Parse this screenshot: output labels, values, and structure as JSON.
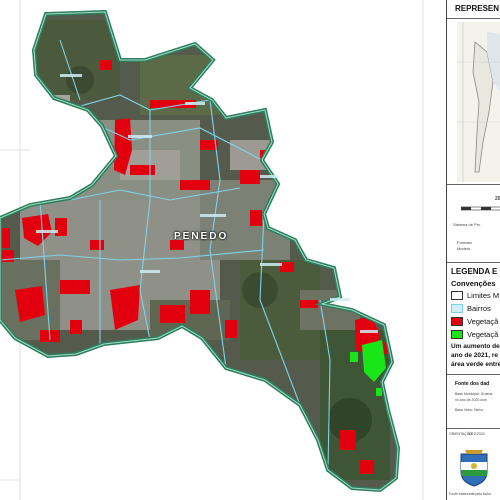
{
  "map": {
    "city_name": "PENEDO",
    "colors": {
      "boundary": "#2e7d5e",
      "bairros": "#7fd3e6",
      "vegetation_loss": "#e2000f",
      "vegetation_gain": "#19e619",
      "imagery_dark": "#3a4233",
      "imagery_light": "#8c8f86"
    }
  },
  "panel": {
    "title": "REPRESEN",
    "scale_number": "20",
    "info_lines": [
      "Sistema de Pro",
      "Formato",
      "Modelo"
    ],
    "legend_title": "LEGENDA E C",
    "conventions_title": "Convenções",
    "legend_items": [
      {
        "label": "Limites M",
        "color": "#ffffff",
        "icon": "boundary-swatch"
      },
      {
        "label": "Bairros",
        "color": "#cfeff6",
        "icon": "bairros-swatch"
      },
      {
        "label": "Vegetaçã",
        "color": "#e2000f",
        "icon": "vegetation-loss-swatch"
      },
      {
        "label": "Vegetaçã",
        "color": "#19e619",
        "icon": "vegetation-gain-swatch"
      }
    ],
    "note_lines": [
      "Um aumento de",
      "ano de 2021, re",
      "área verde entre"
    ],
    "source_title": "Fonte dos dad",
    "source_lines": [
      "Base Municipal: Ordena",
      "no ano de 2020 com",
      "Base Vetor: Ninho"
    ],
    "bottom_left_text": "ORIENTAÇÃO",
    "bottom_right_text": "DEZ/2024",
    "footer_text": "Fonte elaborada pelo Autor"
  }
}
